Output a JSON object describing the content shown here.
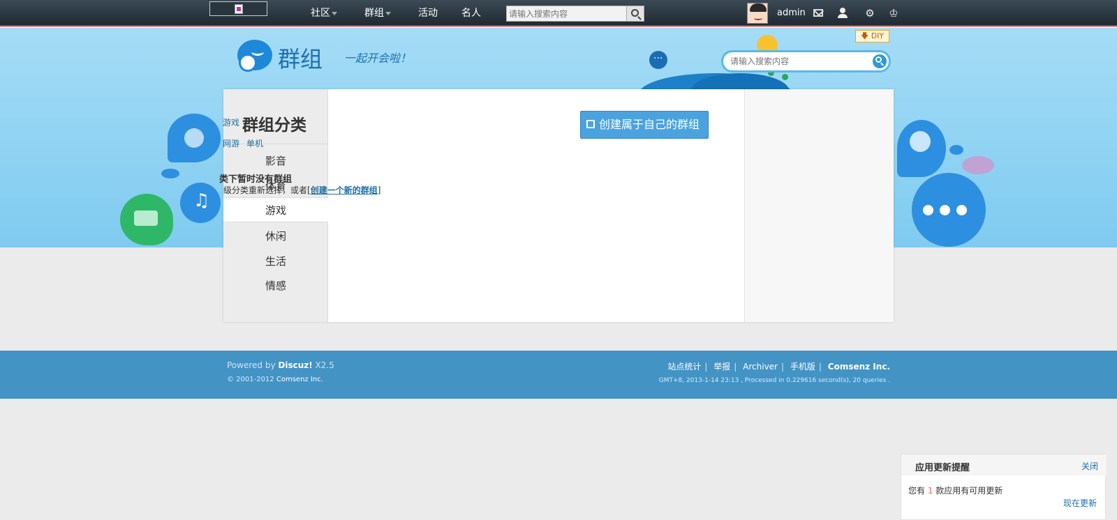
{
  "topbar": {
    "nav": [
      {
        "label": "社区",
        "has_dropdown": true
      },
      {
        "label": "群组",
        "has_dropdown": true
      },
      {
        "label": "活动",
        "has_dropdown": false
      },
      {
        "label": "名人",
        "has_dropdown": false
      }
    ],
    "search_placeholder": "请输入搜索内容",
    "username": "admin",
    "icons": [
      "mail-icon",
      "user-icon",
      "gear-icon",
      "crown-icon"
    ]
  },
  "banner": {
    "diy_label": "DIY",
    "title": "群组",
    "slogan": "一起开会啦！",
    "search_placeholder": "请输入搜索内容"
  },
  "sidebar": {
    "title": "群组分类",
    "items": [
      "影音",
      "体育",
      "游戏",
      "休闲",
      "生活",
      "情感"
    ],
    "active": "游戏"
  },
  "content": {
    "breadcrumb_category": "游戏",
    "sub_links": [
      "网游",
      "单机"
    ],
    "empty_title": "类下暂时没有群组",
    "empty_text_prefix": "级分类重新选择，或者[",
    "empty_link": "创建一个新的群组",
    "empty_text_suffix": "]",
    "create_button": "创建属于自己的群组"
  },
  "footer": {
    "powered_prefix": "Powered by ",
    "powered_brand": "Discuz!",
    "powered_version": " X2.5",
    "copyright_prefix": "© 2001-2012 ",
    "copyright_company": "Comsenz Inc.",
    "links": [
      "站点统计",
      "举报",
      "Archiver",
      "手机版"
    ],
    "company": "Comsenz Inc.",
    "meta": "GMT+8, 2013-1-14 23:13 , Processed in 0.229616 second(s), 20 queries ."
  },
  "notify": {
    "title": "应用更新提醒",
    "close_label": "关闭",
    "text_prefix": "您有 ",
    "count": "1",
    "text_suffix": " 款应用有可用更新",
    "update_label": "现在更新"
  },
  "colors": {
    "topbar": "#1f2a32",
    "banner": "#a5dcf6",
    "footer": "#4393c5",
    "accent_button": "#4aa3de",
    "link": "#1d6fa5"
  }
}
